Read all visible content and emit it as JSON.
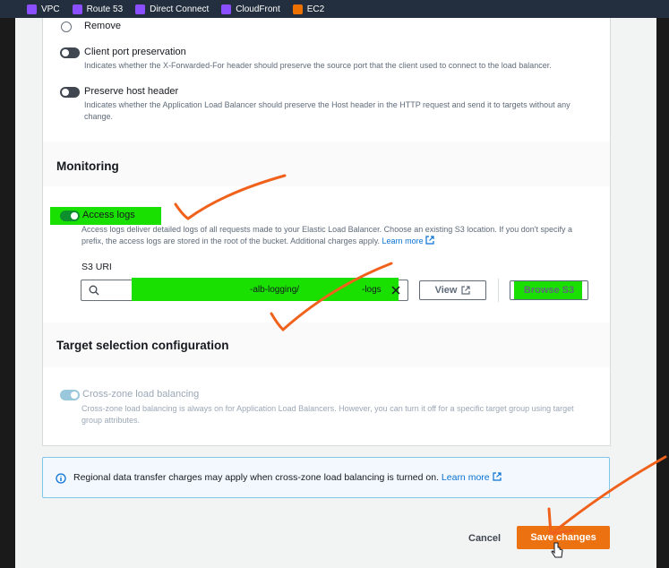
{
  "services": [
    {
      "label": "VPC",
      "icon": "vpc-icon"
    },
    {
      "label": "Route 53",
      "icon": "route53-icon"
    },
    {
      "label": "Direct Connect",
      "icon": "direct-connect-icon"
    },
    {
      "label": "CloudFront",
      "icon": "cloudfront-icon"
    },
    {
      "label": "EC2",
      "icon": "ec2-icon"
    }
  ],
  "header_options": {
    "remove_label": "Remove",
    "client_port": {
      "label": "Client port preservation",
      "description": "Indicates whether the X-Forwarded-For header should preserve the source port that the client used to connect to the load balancer."
    },
    "preserve_host": {
      "label": "Preserve host header",
      "description": "Indicates whether the Application Load Balancer should preserve the Host header in the HTTP request and send it to targets without any change."
    }
  },
  "monitoring": {
    "title": "Monitoring",
    "access_logs": {
      "label": "Access logs",
      "enabled": true,
      "description": "Access logs deliver detailed logs of all requests made to your Elastic Load Balancer. Choose an existing S3 location. If you don't specify a prefix, the access logs are stored in the root of the bucket. Additional charges apply.",
      "learn_more": "Learn more"
    },
    "s3_uri": {
      "label": "S3 URI",
      "value_part1": "-alb-logging/",
      "value_part2": "-logs"
    },
    "view_button": "View",
    "browse_button": "Browse S3"
  },
  "target_selection": {
    "title": "Target selection configuration",
    "cross_zone": {
      "label": "Cross-zone load balancing",
      "enabled": true,
      "disabled_control": true,
      "description": "Cross-zone load balancing is always on for Application Load Balancers. However, you can turn it off for a specific target group using target group attributes."
    }
  },
  "info_alert": {
    "text": "Regional data transfer charges may apply when cross-zone load balancing is turned on.",
    "learn_more": "Learn more"
  },
  "footer": {
    "cancel": "Cancel",
    "save": "Save changes"
  },
  "colors": {
    "topbar": "#232f3e",
    "primary_button": "#ec7211",
    "highlight": "#19e000",
    "annotation": "#f0621c",
    "link": "#0972d3"
  }
}
